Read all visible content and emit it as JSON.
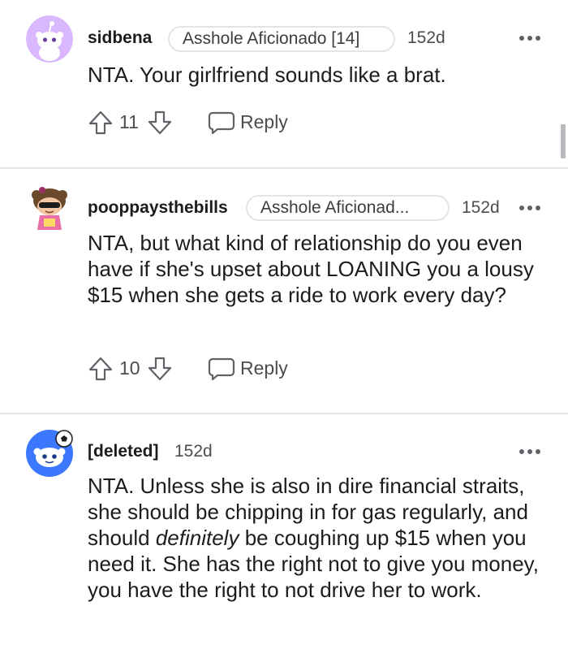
{
  "comments": [
    {
      "username": "sidbena",
      "flair": "Asshole Aficionado [14]",
      "age": "152d",
      "body": "NTA. Your girlfriend sounds like a brat.",
      "score": "11",
      "reply_label": "Reply",
      "avatar": "purple-snoo-avatar"
    },
    {
      "username": "pooppaysthebills",
      "flair": "Asshole Aficionad...",
      "age": "152d",
      "body": "NTA, but what kind of relationship do you even have if she's upset about LOANING you a lousy $15 when she gets a ride to work every day?",
      "score": "10",
      "reply_label": "Reply",
      "avatar": "custom-snoo-sunglasses-avatar"
    },
    {
      "username": "[deleted]",
      "age": "152d",
      "body_before": "NTA. Unless she is also in dire financial straits, she should be chipping in for gas regularly, and should ",
      "body_emphasis": "definitely",
      "body_after": " be coughing up $15 when you need it. She has the right not to give you money, you have the right to not drive her to work.",
      "avatar": "soccer-ball-snoo-avatar"
    }
  ],
  "icons": {
    "upvote": "upvote-arrow-icon",
    "downvote": "downvote-arrow-icon",
    "reply": "speech-bubble-icon",
    "more": "more-options-icon"
  },
  "colors": {
    "text": "#1c1c1c",
    "secondary_text": "#4a4d52",
    "flair_border": "#e2e4e7",
    "divider": "#e4e5e7",
    "avatar_purple": "#d9b8ff",
    "avatar_blue": "#3c78ff"
  }
}
